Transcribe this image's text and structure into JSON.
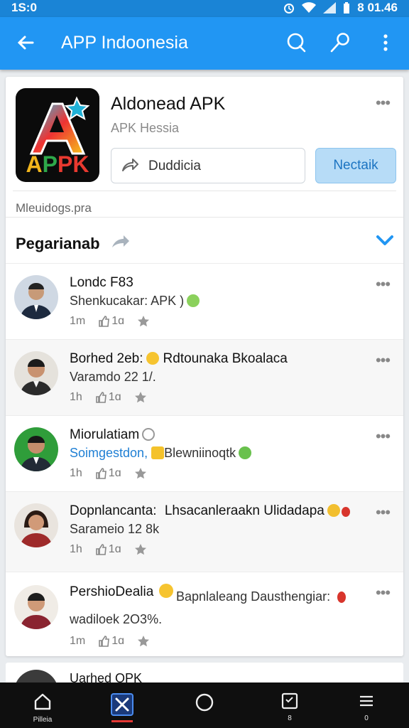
{
  "status": {
    "time": "1S:0",
    "clock": "8 01.46"
  },
  "appbar": {
    "title": "APP Indoonesia"
  },
  "app": {
    "name": "Aldonead APK",
    "subtitle": "APK Hessia",
    "outline_button": "Duddicia",
    "fill_button": "Nectaik",
    "meta": "Mleuidogs.pra"
  },
  "section": {
    "title": "Pegarianab"
  },
  "posts": [
    {
      "name": "Londc F83",
      "line2": "Shenkucakar: APK )",
      "time": "1m",
      "likes": "1ɑ"
    },
    {
      "name": "Borhed 2eb:",
      "name_tail": "Rdtounaka Bkoalaca",
      "line2": "Varamdo 22 1/.",
      "time": "1h",
      "likes": "1ɑ"
    },
    {
      "name": "Miorulatiam",
      "line2_blue": "Soimgestdon,",
      "line2": "Blewniinoqtk",
      "time": "1h",
      "likes": "1ɑ"
    },
    {
      "name": "Dopnlancanta:",
      "name_tail": "Lhsacanleraakn Ulidadapa",
      "line2": "Sarameio 12 8k",
      "time": "1h",
      "likes": "1ɑ"
    },
    {
      "name": "PershioDealia",
      "name_tail": "Bapnlaleang Dausthengiar:",
      "line2": "wadiloek 2O3%.",
      "time": "1m",
      "likes": "1ɑ"
    }
  ],
  "peek": {
    "name": "Uarhed OPK"
  },
  "navbar": {
    "items": [
      "Pilleia",
      "",
      "",
      "8",
      "0"
    ]
  },
  "colors": {
    "primary": "#2196f3",
    "accent_light": "#b7dcf7",
    "navbar": "#0f0f0f"
  }
}
